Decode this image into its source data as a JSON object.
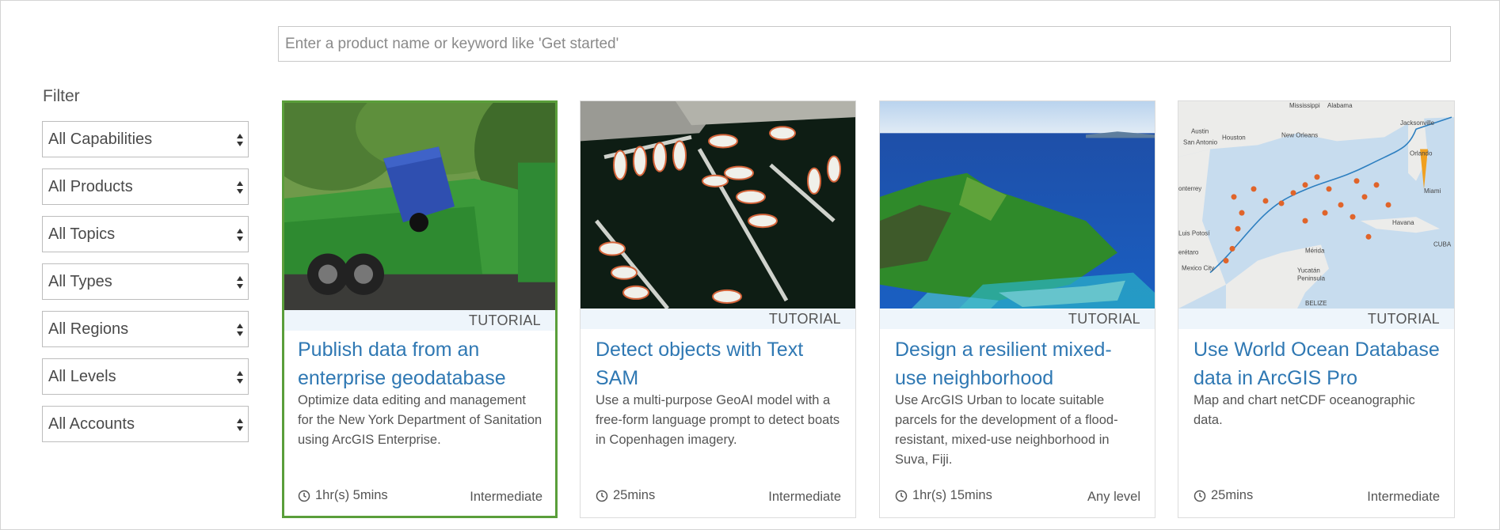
{
  "search": {
    "placeholder": "Enter a product name or keyword like 'Get started'"
  },
  "filter": {
    "title": "Filter",
    "selects": [
      {
        "value": "All Capabilities"
      },
      {
        "value": "All Products"
      },
      {
        "value": "All Topics"
      },
      {
        "value": "All Types"
      },
      {
        "value": "All Regions"
      },
      {
        "value": "All Levels"
      },
      {
        "value": "All Accounts"
      }
    ]
  },
  "cards": [
    {
      "tag": "TUTORIAL",
      "title": "Publish data from an enterprise geodatabase",
      "description": "Optimize data editing and management for the New York Department of Sanitation using ArcGIS Enterprise.",
      "duration": "1hr(s) 5mins",
      "level": "Intermediate",
      "image": "garbage-truck-photo"
    },
    {
      "tag": "TUTORIAL",
      "title": "Detect objects with Text SAM",
      "description": "Use a multi-purpose GeoAI model with a free-form language prompt to detect boats in Copenhagen imagery.",
      "duration": "25mins",
      "level": "Intermediate",
      "image": "marina-aerial-photo"
    },
    {
      "tag": "TUTORIAL",
      "title": "Design a resilient mixed-use neighborhood",
      "description": "Use ArcGIS Urban to locate suitable parcels for the development of a flood-resistant, mixed-use neighborhood in Suva, Fiji.",
      "duration": "1hr(s) 15mins",
      "level": "Any level",
      "image": "island-coast-photo"
    },
    {
      "tag": "TUTORIAL",
      "title": "Use World Ocean Database data in ArcGIS Pro",
      "description": "Map and chart netCDF oceanographic data.",
      "duration": "25mins",
      "level": "Intermediate",
      "image": "gulf-of-mexico-map",
      "map_labels": [
        "Mississippi",
        "Alabama",
        "Austin",
        "Houston",
        "New Orleans",
        "San Antonio",
        "Jacksonville",
        "Orlando",
        "Miami",
        "Monterrey",
        "Havana",
        "San Luis Potosí",
        "Mérida",
        "Querétaro",
        "Mexico City",
        "CUBA",
        "Yucatán Peninsula",
        "BELIZE"
      ]
    }
  ],
  "colors": {
    "link": "#2f78b3",
    "selected_border": "#5a9e3a",
    "tag_band": "#eef5fb"
  },
  "icons": {
    "duration": "clock-icon",
    "select": "sort-arrows-icon"
  }
}
